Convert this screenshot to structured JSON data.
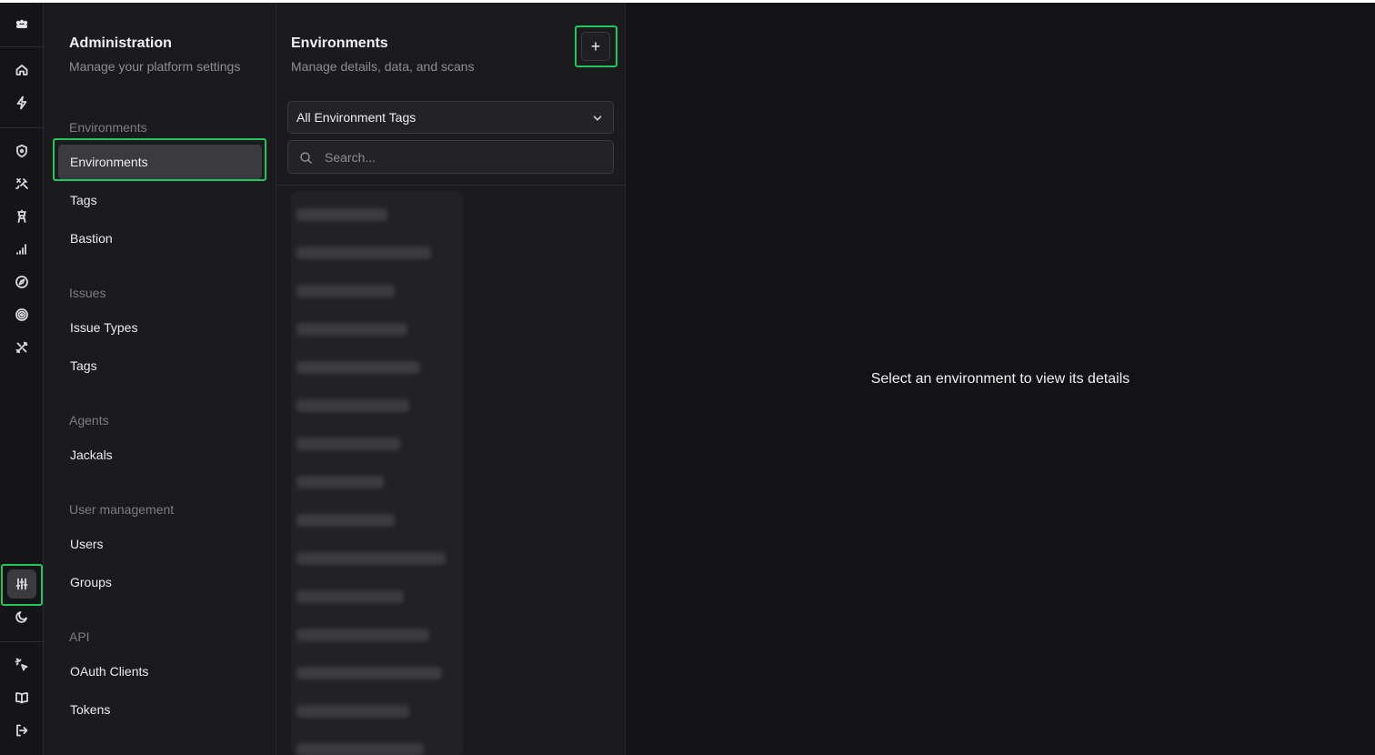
{
  "rail": {
    "items": [
      {
        "icon": "logo-icon"
      },
      {
        "icon": "home-icon"
      },
      {
        "icon": "bolt-icon"
      },
      {
        "icon": "shield-icon"
      },
      {
        "icon": "satellite-icon"
      },
      {
        "icon": "tower-icon"
      },
      {
        "icon": "signal-icon"
      },
      {
        "icon": "compass-icon"
      },
      {
        "icon": "target-icon"
      },
      {
        "icon": "tools-icon"
      },
      {
        "icon": "sliders-icon",
        "active": true
      },
      {
        "icon": "moon-icon"
      },
      {
        "icon": "sparkle-pointer-icon"
      },
      {
        "icon": "book-icon"
      },
      {
        "icon": "logout-icon"
      }
    ]
  },
  "admin": {
    "title": "Administration",
    "subtitle": "Manage your platform settings",
    "sections": [
      {
        "label": "Environments",
        "items": [
          "Environments",
          "Tags",
          "Bastion"
        ]
      },
      {
        "label": "Issues",
        "items": [
          "Issue Types",
          "Tags"
        ]
      },
      {
        "label": "Agents",
        "items": [
          "Jackals"
        ]
      },
      {
        "label": "User management",
        "items": [
          "Users",
          "Groups"
        ]
      },
      {
        "label": "API",
        "items": [
          "OAuth Clients",
          "Tokens"
        ]
      }
    ],
    "active_item": "Environments"
  },
  "environments": {
    "title": "Environments",
    "subtitle": "Manage details, data, and scans",
    "add_label": "+",
    "filter": {
      "selected": "All Environment Tags"
    },
    "search": {
      "placeholder": "Search...",
      "value": ""
    }
  },
  "detail": {
    "empty_message": "Select an environment to view its details"
  },
  "colors": {
    "highlight": "#22c55e",
    "background": "#151517",
    "active": "#3a3a3f"
  }
}
